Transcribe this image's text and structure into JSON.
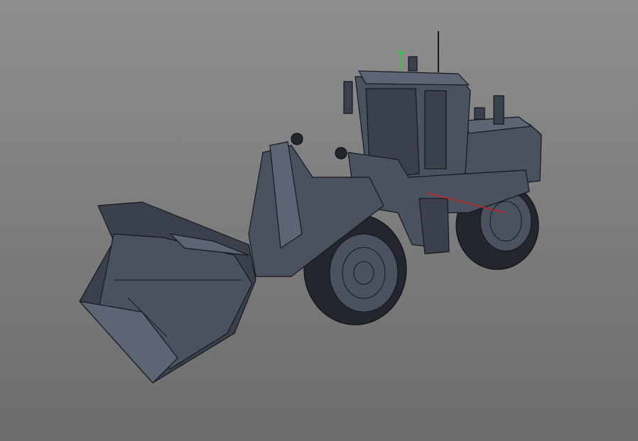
{
  "viewport": {
    "background_top": "#8e8e8e",
    "background_bottom": "#6c6c6c",
    "model": "wheel-loader",
    "gizmo": {
      "y_axis_color": "#22cc33",
      "x_axis_color": "#cc2222"
    }
  }
}
